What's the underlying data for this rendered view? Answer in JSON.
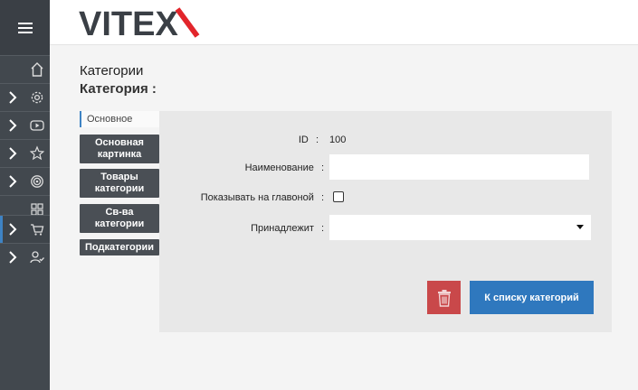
{
  "brand": {
    "name": "VITEX",
    "accent": "#e2252b",
    "dark": "#3a3f45"
  },
  "page": {
    "title": "Категории",
    "subtitle": "Категория :"
  },
  "tabs": {
    "basic": "Основное",
    "main_image": "Основная картинка",
    "category_goods": "Товары категории",
    "category_props": "Св-ва категории",
    "subcategories": "Подкатегории"
  },
  "form": {
    "id_label": "ID",
    "id_sep": ":",
    "id_value": "100",
    "name_label": "Наименование",
    "name_sep": ":",
    "name_value": "",
    "show_main_label": "Показывать на главоной",
    "show_main_sep": ":",
    "show_main_checked": false,
    "belongs_label": "Принадлежит",
    "belongs_sep": ":",
    "belongs_value": ""
  },
  "actions": {
    "back_to_list": "К списку категорий"
  },
  "sidebar": {
    "items": [
      {
        "icon": "home-icon",
        "chevron": false
      },
      {
        "icon": "gear-icon",
        "chevron": true
      },
      {
        "icon": "video-icon",
        "chevron": true
      },
      {
        "icon": "star-icon",
        "chevron": true
      },
      {
        "icon": "target-icon",
        "chevron": true
      },
      {
        "icon": "grid-icon",
        "chevron": false
      },
      {
        "icon": "cart-icon",
        "chevron": true,
        "active": true
      },
      {
        "icon": "user-check-icon",
        "chevron": true
      }
    ]
  }
}
